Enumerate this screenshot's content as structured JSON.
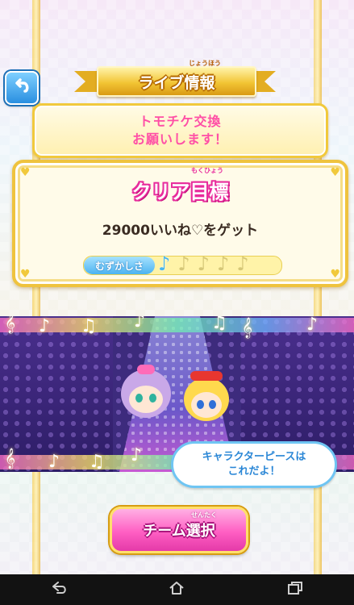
{
  "header": {
    "title": "ライブ情報",
    "title_ruby": "じょうほう"
  },
  "request": {
    "line1": "トモチケ交換",
    "line2": "お願いします！"
  },
  "goal": {
    "title": "クリア目標",
    "title_ruby": "もくひょう",
    "text": "29000いいね♡をゲット",
    "difficulty_label": "むずかしさ",
    "difficulty_level": 1,
    "difficulty_max": 5
  },
  "hint": {
    "line1": "キャラクターピースは",
    "line2": "これだよ！"
  },
  "team_button": {
    "label": "チーム選択",
    "ruby": "せんたく"
  },
  "colors": {
    "accent_pink": "#ff4fa6",
    "gold": "#efc33e",
    "note_active": "#49b5ee",
    "bubble_text": "#2b87d6"
  },
  "icons": {
    "back": "back-arrow-icon",
    "nav_back": "nav-back-icon",
    "nav_home": "nav-home-icon",
    "nav_recent": "nav-recent-apps-icon"
  }
}
